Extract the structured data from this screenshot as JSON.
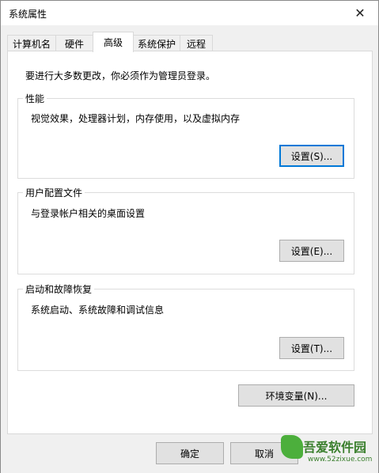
{
  "window": {
    "title": "系统属性",
    "close_glyph": "✕"
  },
  "tabs": [
    {
      "label": "计算机名"
    },
    {
      "label": "硬件"
    },
    {
      "label": "高级",
      "active": true
    },
    {
      "label": "系统保护"
    },
    {
      "label": "远程"
    }
  ],
  "intro": "要进行大多数更改，你必须作为管理员登录。",
  "performance": {
    "title": "性能",
    "desc": "视觉效果，处理器计划，内存使用，以及虚拟内存",
    "button": "设置(S)..."
  },
  "user_profiles": {
    "title": "用户配置文件",
    "desc": "与登录帐户相关的桌面设置",
    "button": "设置(E)..."
  },
  "startup_recovery": {
    "title": "启动和故障恢复",
    "desc": "系统启动、系统故障和调试信息",
    "button": "设置(T)..."
  },
  "env_button": "环境变量(N)...",
  "footer": {
    "ok": "确定",
    "cancel": "取消"
  },
  "watermark": {
    "main": "吾爱软件园",
    "sub": "www.52zixue.com",
    "top": "ik下载"
  }
}
